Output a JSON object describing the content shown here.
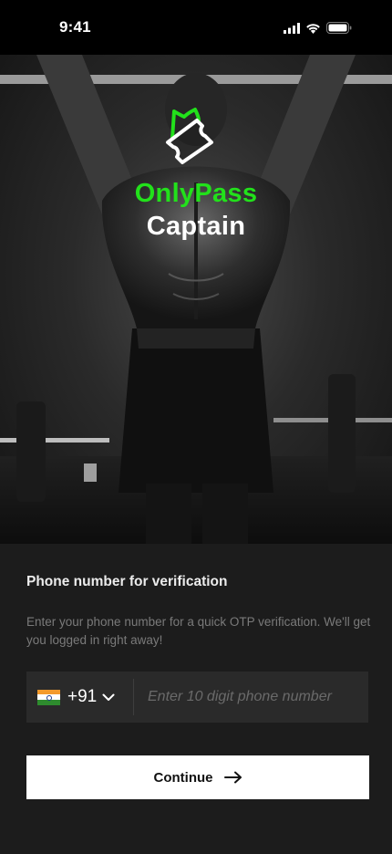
{
  "status_bar": {
    "time": "9:41"
  },
  "brand": {
    "name_line1": "OnlyPass",
    "name_line2": "Captain",
    "accent": "#22e11b"
  },
  "form": {
    "title": "Phone number for verification",
    "description": "Enter your phone number for a quick OTP verification. We'll get you logged in right away!",
    "country_code": "+91",
    "country_flag": "india-flag-icon",
    "phone_placeholder": "Enter 10 digit phone number",
    "phone_value": "",
    "continue_label": "Continue"
  },
  "colors": {
    "background": "#1c1c1c",
    "input_bg": "#2a2a2a",
    "button_bg": "#ffffff"
  }
}
